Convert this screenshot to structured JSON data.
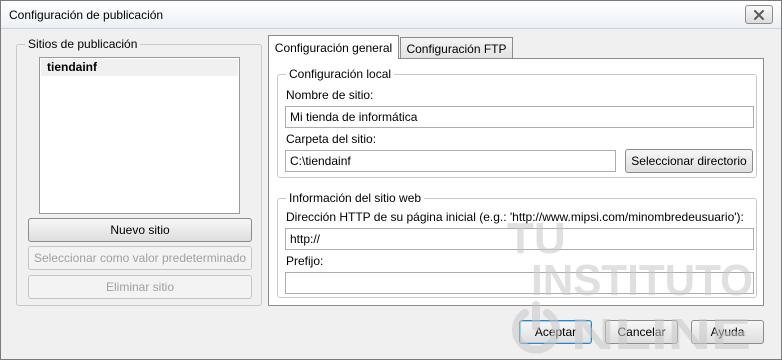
{
  "window": {
    "title": "Configuración de publicación"
  },
  "sites": {
    "legend": "Sitios de publicación",
    "items": [
      "tiendainf"
    ],
    "new_button": "Nuevo sitio",
    "set_default_button": "Seleccionar como valor predeterminado",
    "delete_button": "Eliminar sitio"
  },
  "tabs": [
    "Configuración general",
    "Configuración FTP"
  ],
  "local": {
    "legend": "Configuración local",
    "site_name_label": "Nombre de sitio:",
    "site_name_value": "Mi tienda de informática",
    "site_folder_label": "Carpeta del sitio:",
    "site_folder_value": "C:\\tiendainf",
    "select_dir_button": "Seleccionar directorio"
  },
  "web": {
    "legend": "Información del sitio web",
    "http_label": "Dirección HTTP de su página inicial (e.g.: 'http://www.mipsi.com/minombredeusuario'):",
    "http_value": "http://",
    "prefix_label": "Prefijo:",
    "prefix_value": ""
  },
  "footer": {
    "accept": "Aceptar",
    "cancel": "Cancelar",
    "help": "Ayuda"
  },
  "watermark": {
    "line1": "TU",
    "line2": "INSTITUTO",
    "line3": "NLINE",
    "color": "#c8c8c8"
  },
  "colors": {
    "close_icon": "#5a5a5a",
    "selected_item_bg": "#f0f0f0"
  }
}
